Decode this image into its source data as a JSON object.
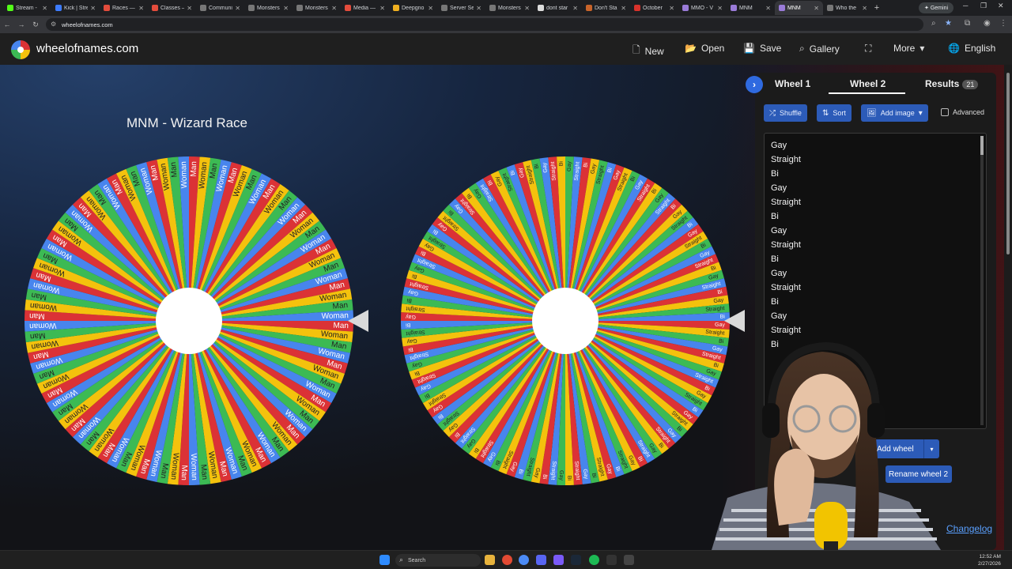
{
  "browser": {
    "tabs": [
      {
        "label": "Stream - ",
        "color": "#53fc18"
      },
      {
        "label": "Kick | Stre",
        "color": "#3d7cff"
      },
      {
        "label": "Races — ",
        "color": "#e34c3c"
      },
      {
        "label": "Classes — ",
        "color": "#e34c3c"
      },
      {
        "label": "Communi",
        "color": "#777777"
      },
      {
        "label": "Monsters",
        "color": "#777777"
      },
      {
        "label": "Monsters",
        "color": "#777777"
      },
      {
        "label": "Media — ",
        "color": "#e34c3c"
      },
      {
        "label": "Deepgno",
        "color": "#f0b020"
      },
      {
        "label": "Server Se",
        "color": "#777777"
      },
      {
        "label": "Monsters",
        "color": "#777777"
      },
      {
        "label": "dont star",
        "color": "#dddddd"
      },
      {
        "label": "Don't Sta",
        "color": "#c8642a"
      },
      {
        "label": "October",
        "color": "#d8322b"
      },
      {
        "label": "MMO - V",
        "color": "#9a7bd8"
      },
      {
        "label": "MNM",
        "color": "#9a7bd8"
      },
      {
        "label": "MNM",
        "color": "#9a7bd8"
      },
      {
        "label": "Who the",
        "color": "#777777"
      }
    ],
    "active_tab_index": 16,
    "gemini_label": "Gemini",
    "url": "wheelofnames.com"
  },
  "site": {
    "name": "wheelofnames.com",
    "menu": {
      "new": "New",
      "open": "Open",
      "save": "Save",
      "gallery": "Gallery",
      "more": "More",
      "language": "English"
    }
  },
  "wheel1": {
    "title": "MNM - Wizard Race",
    "entries": [
      "Man",
      "Woman"
    ],
    "colors": [
      "#db3236",
      "#f4c20d",
      "#3cba54",
      "#4885ed"
    ]
  },
  "wheel2": {
    "entries": [
      "Gay",
      "Straight",
      "Bi"
    ],
    "colors": [
      "#db3236",
      "#f4c20d",
      "#3cba54",
      "#4885ed"
    ]
  },
  "panel": {
    "tabs": {
      "wheel1": "Wheel 1",
      "wheel2": "Wheel 2",
      "results": "Results",
      "results_count": "21"
    },
    "buttons": {
      "shuffle": "Shuffle",
      "sort": "Sort",
      "add_image": "Add image",
      "advanced": "Advanced"
    },
    "entries": [
      "Gay",
      "Straight",
      "Bi",
      "Gay",
      "Straight",
      "Bi",
      "Gay",
      "Straight",
      "Bi",
      "Gay",
      "Straight",
      "Bi",
      "Gay",
      "Straight",
      "Bi"
    ],
    "add_wheel": "Add wheel",
    "rename_wheel": "Rename wheel 2",
    "changelog": "Changelog"
  },
  "taskbar": {
    "search_placeholder": "Search",
    "time": "12:52 AM",
    "date": "2/27/2026"
  }
}
